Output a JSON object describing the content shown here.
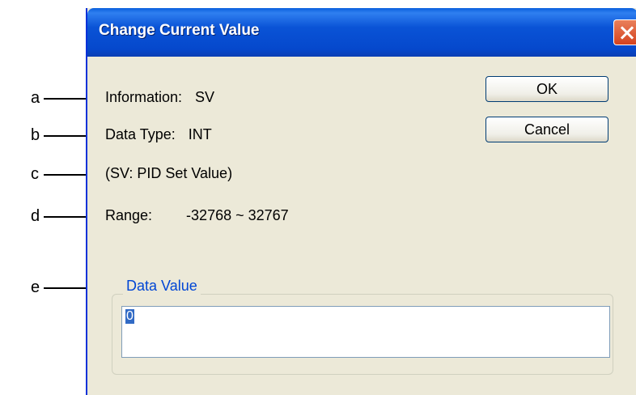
{
  "dialog": {
    "title": "Change Current Value",
    "information_label": "Information:",
    "information_value": "SV",
    "datatype_label": "Data Type:",
    "datatype_value": "INT",
    "description": "(SV: PID Set Value)",
    "range_label": "Range:",
    "range_value": "-32768 ~ 32767",
    "ok_label": "OK",
    "cancel_label": "Cancel",
    "group_label": "Data Value",
    "data_value": "0"
  },
  "callouts": [
    "a",
    "b",
    "c",
    "d",
    "e"
  ],
  "colors": {
    "titlebar": "#0a53d6",
    "dialog_bg": "#ece9d8",
    "legend_text": "#0046d5",
    "selection": "#316ac5"
  }
}
